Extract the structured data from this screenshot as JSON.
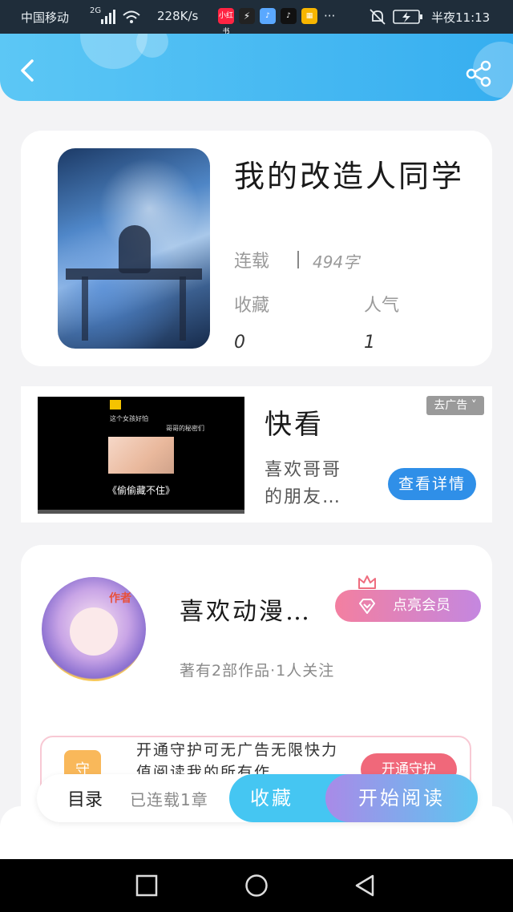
{
  "status_bar": {
    "carrier": "中国移动",
    "network": "2G",
    "speed": "228K/s",
    "app1": "小红书",
    "time": "半夜11:13"
  },
  "header": {
    "back_icon": "chevron-left-icon",
    "share_icon": "share-icon"
  },
  "book": {
    "title": "我的改造人同学",
    "status": "连载",
    "word_count": "494字",
    "favorites_label": "收藏",
    "popularity_label": "人气",
    "favorites_value": "0",
    "popularity_value": "1"
  },
  "ad": {
    "video_line1": "这个女孩好怕",
    "video_line2": "哥哥的秘密们",
    "video_caption": "《偷偷藏不住》",
    "title": "快看",
    "description": "喜欢哥哥的朋友…",
    "remove_label": "去广告",
    "detail_button": "查看详情"
  },
  "author": {
    "badge": "作者",
    "name": "喜欢动漫…",
    "vip_button": "点亮会员",
    "meta": "著有2部作品·1人关注",
    "promo_text": "开通守护可无广告无限快力值阅读我的所有作",
    "promo_icon_char": "守",
    "promo_button": "开通守护"
  },
  "action_bar": {
    "toc": "目录",
    "chapters": "已连载1章",
    "favorite": "收藏",
    "start_reading": "开始阅读"
  },
  "colors": {
    "header_blue": "#36aef0",
    "vip_pink": "#f37fa0",
    "favorite_blue": "#45c6f2",
    "read_purple": "#a98ae8"
  }
}
